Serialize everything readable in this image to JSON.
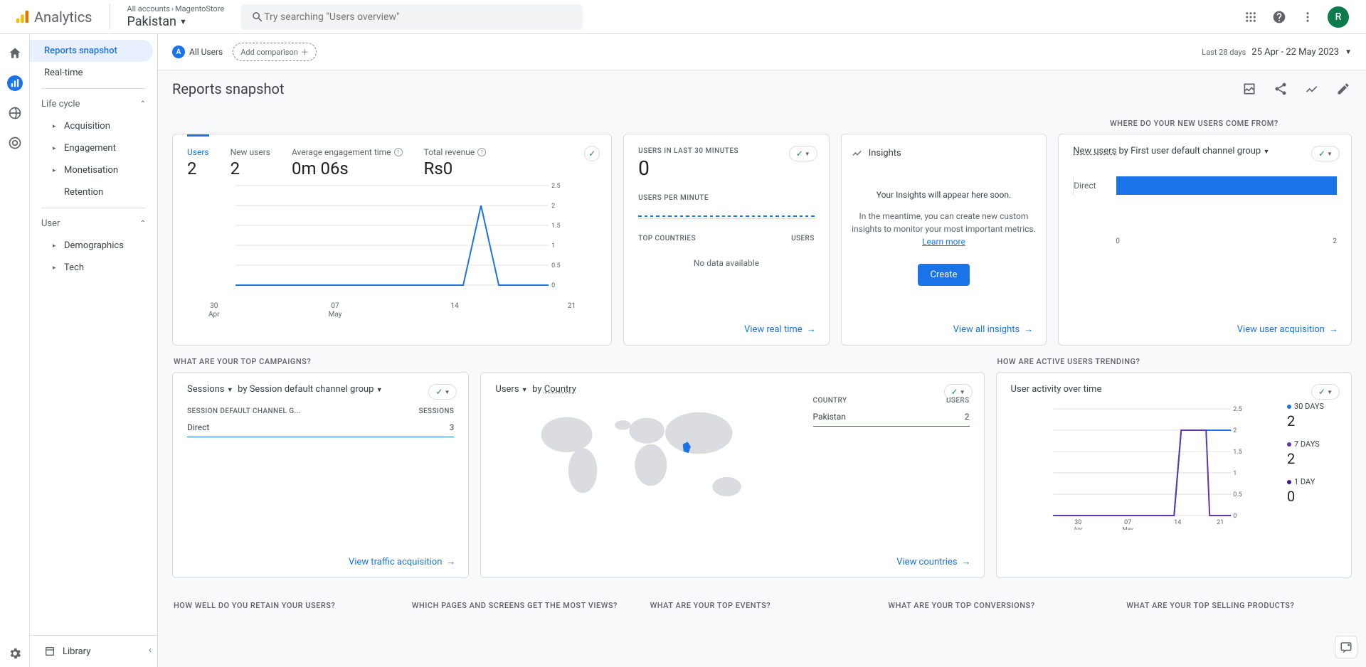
{
  "header": {
    "logo_text": "Analytics",
    "breadcrumb_all": "All accounts",
    "breadcrumb_acct": "MagentoStore",
    "property": "Pakistan",
    "search_placeholder": "Try searching \"Users overview\"",
    "avatar_letter": "R"
  },
  "segment": {
    "badge": "A",
    "label": "All Users",
    "add": "Add comparison",
    "date_label": "Last 28 days",
    "date_range": "25 Apr - 22 May 2023"
  },
  "title": "Reports snapshot",
  "sidebar": {
    "snapshot": "Reports snapshot",
    "realtime": "Real-time",
    "lifecycle": "Life cycle",
    "acquisition": "Acquisition",
    "engagement": "Engagement",
    "monetisation": "Monetisation",
    "retention": "Retention",
    "user": "User",
    "demographics": "Demographics",
    "tech": "Tech",
    "library": "Library"
  },
  "overview": {
    "users_lbl": "Users",
    "users_val": "2",
    "newusers_lbl": "New users",
    "newusers_val": "2",
    "avgeng_lbl": "Average engagement time",
    "avgeng_val": "0m 06s",
    "revenue_lbl": "Total revenue",
    "revenue_val": "Rs0",
    "x": {
      "a": "30",
      "a2": "Apr",
      "b": "07",
      "b2": "May",
      "c": "14",
      "d": "21"
    },
    "y": {
      "a": "2.5",
      "b": "2",
      "c": "1.5",
      "d": "1",
      "e": "0.5",
      "f": "0"
    }
  },
  "realtime": {
    "head": "USERS IN LAST 30 MINUTES",
    "val": "0",
    "upm": "USERS PER MINUTE",
    "tc": "TOP COUNTRIES",
    "users": "USERS",
    "nodata": "No data available",
    "link": "View real time"
  },
  "insights": {
    "head": "Insights",
    "l1": "Your Insights will appear here soon.",
    "l2": "In the meantime, you can create new custom insights to monitor your most important metrics.",
    "learn": "Learn more",
    "btn": "Create",
    "link": "View all insights"
  },
  "newusers_card": {
    "out_title": "WHERE DO YOUR NEW USERS COME FROM?",
    "dim1": "New users",
    "by": "by First user default channel group",
    "bar_label": "Direct",
    "axis0": "0",
    "axis1": "2",
    "link": "View user acquisition"
  },
  "campaigns": {
    "out_title": "WHAT ARE YOUR TOP CAMPAIGNS?",
    "dim": "Sessions",
    "by": "by Session default channel group",
    "col1": "SESSION DEFAULT CHANNEL G...",
    "col2": "SESSIONS",
    "row_label": "Direct",
    "row_val": "3",
    "link": "View traffic acquisition"
  },
  "countries": {
    "dim": "Users",
    "by_label": "by",
    "by_dim": "Country",
    "col1": "COUNTRY",
    "col2": "USERS",
    "row_label": "Pakistan",
    "row_val": "2",
    "link": "View countries"
  },
  "trending": {
    "out_title": "HOW ARE ACTIVE USERS TRENDING?",
    "head": "User activity over time",
    "leg1": "30 DAYS",
    "leg1_val": "2",
    "leg2": "7 DAYS",
    "leg2_val": "2",
    "leg3": "1 DAY",
    "leg3_val": "0",
    "y": {
      "a": "2.5",
      "b": "2",
      "c": "1.5",
      "d": "1",
      "e": "0.5",
      "f": "0"
    },
    "x": {
      "a": "30",
      "a2": "Apr",
      "b": "07",
      "b2": "May",
      "c": "14",
      "d": "21"
    }
  },
  "footer_sections": {
    "a": "HOW WELL DO YOU RETAIN YOUR USERS?",
    "b": "WHICH PAGES AND SCREENS GET THE MOST VIEWS?",
    "c": "WHAT ARE YOUR TOP EVENTS?",
    "d": "WHAT ARE YOUR TOP CONVERSIONS?",
    "e": "WHAT ARE YOUR TOP SELLING PRODUCTS?"
  },
  "chart_data": [
    {
      "type": "line",
      "title": "Users",
      "x": [
        "30 Apr",
        "01 May",
        "02 May",
        "03 May",
        "04 May",
        "05 May",
        "06 May",
        "07 May",
        "08 May",
        "09 May",
        "10 May",
        "11 May",
        "12 May",
        "13 May",
        "14 May",
        "15 May",
        "16 May",
        "17 May",
        "18 May",
        "19 May",
        "20 May",
        "21 May"
      ],
      "values": [
        0,
        0,
        0,
        0,
        0,
        0,
        0,
        0,
        0,
        0,
        0,
        0,
        0,
        0,
        0,
        0,
        2,
        0,
        0,
        0,
        0,
        0
      ],
      "ylim": [
        0,
        2.5
      ]
    },
    {
      "type": "bar",
      "title": "New users by First user default channel group",
      "categories": [
        "Direct"
      ],
      "values": [
        2
      ],
      "xlim": [
        0,
        2
      ]
    },
    {
      "type": "table",
      "title": "Sessions by Session default channel group",
      "columns": [
        "Session default channel group",
        "Sessions"
      ],
      "rows": [
        [
          "Direct",
          3
        ]
      ]
    },
    {
      "type": "table",
      "title": "Users by Country",
      "columns": [
        "Country",
        "Users"
      ],
      "rows": [
        [
          "Pakistan",
          2
        ]
      ]
    },
    {
      "type": "line",
      "title": "User activity over time",
      "x": [
        "30 Apr",
        "07 May",
        "14 May",
        "21 May"
      ],
      "series": [
        {
          "name": "30 DAYS",
          "values": [
            0,
            0,
            2,
            2
          ]
        },
        {
          "name": "7 DAYS",
          "values": [
            0,
            0,
            2,
            2
          ]
        },
        {
          "name": "1 DAY",
          "values": [
            0,
            0,
            0,
            0
          ]
        }
      ],
      "ylim": [
        0,
        2.5
      ]
    }
  ]
}
